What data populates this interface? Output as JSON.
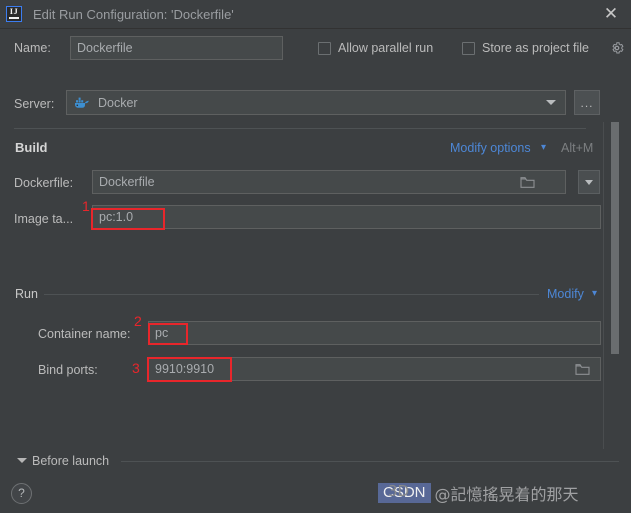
{
  "window": {
    "title": "Edit Run Configuration: 'Dockerfile'",
    "app_icon": "intellij-idea-icon",
    "logo_text": "IJ",
    "close_icon": "close-icon"
  },
  "name_row": {
    "label": "Name:",
    "value": "Dockerfile",
    "allow_parallel_run": {
      "label": "Allow parallel run",
      "checked": false
    },
    "store_as_project_file": {
      "label": "Store as project file",
      "checked": false
    },
    "gear_icon": "gear-icon"
  },
  "server_row": {
    "label": "Server:",
    "value": "Docker",
    "icon": "docker-whale-icon",
    "more_button": "...",
    "dropdown_icon": "chevron-down-icon"
  },
  "build_section": {
    "title": "Build",
    "modify_options": "Modify options",
    "modify_options_caret": "chevron-down-icon",
    "shortcut": "Alt+M",
    "dockerfile": {
      "label": "Dockerfile:",
      "value": "Dockerfile",
      "browse_icon": "folder-icon",
      "dropdown_icon": "chevron-down-icon"
    },
    "image_tag": {
      "label": "Image ta...",
      "value": "pc:1.0"
    }
  },
  "run_section": {
    "title": "Run",
    "modify": "Modify",
    "modify_caret": "chevron-down-icon",
    "container_name": {
      "label": "Container name:",
      "value": "pc"
    },
    "bind_ports": {
      "label": "Bind ports:",
      "value": "9910:9910",
      "browse_icon": "folder-icon"
    }
  },
  "before_launch": {
    "label": "Before launch",
    "expanded": true,
    "toggle_icon": "triangle-down-icon"
  },
  "footer": {
    "help_label": "?",
    "help_icon": "help-icon"
  },
  "annotations": [
    {
      "number": "1",
      "target": "image-tag-field"
    },
    {
      "number": "2",
      "target": "container-name-field"
    },
    {
      "number": "3",
      "target": "bind-ports-field"
    }
  ],
  "watermark": {
    "badge": "CSDN",
    "text": "@記憶搖晃着的那天",
    "overlay": "3D"
  },
  "colors": {
    "background": "#3c3f41",
    "field_background": "#45494a",
    "link": "#4d87d6",
    "annotation_red": "#e8262b",
    "accent_blue": "#3c7df0"
  }
}
